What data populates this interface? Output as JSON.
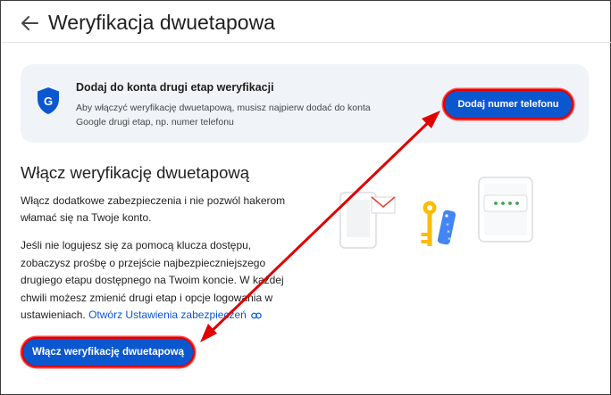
{
  "header": {
    "title": "Weryfikacja dwuetapowa"
  },
  "card": {
    "title": "Dodaj do konta drugi etap weryfikacji",
    "description": "Aby włączyć weryfikację dwuetapową, musisz najpierw dodać do konta Google drugi etap, np. numer telefonu",
    "button_label": "Dodaj numer telefonu"
  },
  "section": {
    "title": "Włącz weryfikację dwuetapową",
    "paragraph1": "Włącz dodatkowe zabezpieczenia i nie pozwól hakerom włamać się na Twoje konto.",
    "paragraph2": "Jeśli nie logujesz się za pomocą klucza dostępu, zobaczysz prośbę o przejście najbezpieczniejszego drugiego etapu dostępnego na Twoim koncie. W każdej chwili możesz zmienić drugi etap i opcje logowania w ustawieniach.",
    "link_label": "Otwórz Ustawienia zabezpieczeń",
    "button_label": "Włącz weryfikację dwuetapową"
  },
  "icons": {
    "back": "arrow-back-icon",
    "shield": "google-shield-icon",
    "link": "link-icon"
  },
  "colors": {
    "primary": "#0b57d0",
    "card_bg": "#f0f4f9",
    "annotation": "#e00000",
    "key_yellow": "#fbbc04"
  }
}
